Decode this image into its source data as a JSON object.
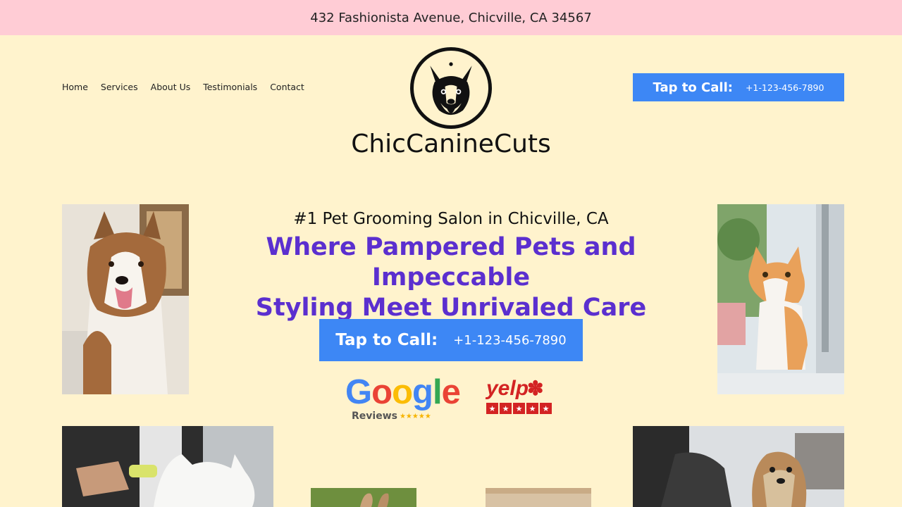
{
  "topbar": {
    "address": "432 Fashionista Avenue, Chicville, CA 34567"
  },
  "nav": {
    "items": [
      "Home",
      "Services",
      "About Us",
      "Testimonials",
      "Contact"
    ]
  },
  "brand": {
    "name": "ChicCanineCuts"
  },
  "header_call": {
    "label": "Tap to Call:",
    "phone": "+1-123-456-7890"
  },
  "hero": {
    "subheading": "#1 Pet Grooming Salon in Chicville, CA",
    "headline_line1": "Where Pampered Pets and Impeccable",
    "headline_line2": "Styling Meet Unrivaled Care",
    "call_label": "Tap to Call:",
    "call_phone": "+1-123-456-7890"
  },
  "badges": {
    "google_word": "Google",
    "google_sub": "Reviews",
    "google_stars": "★★★★★",
    "yelp_word": "yelp",
    "yelp_stars": [
      "★",
      "★",
      "★",
      "★",
      "★"
    ]
  },
  "colors": {
    "topbar": "#ffccd5",
    "background": "#fff3cd",
    "accent": "#3d87f5",
    "headline": "#5b2fcf"
  }
}
